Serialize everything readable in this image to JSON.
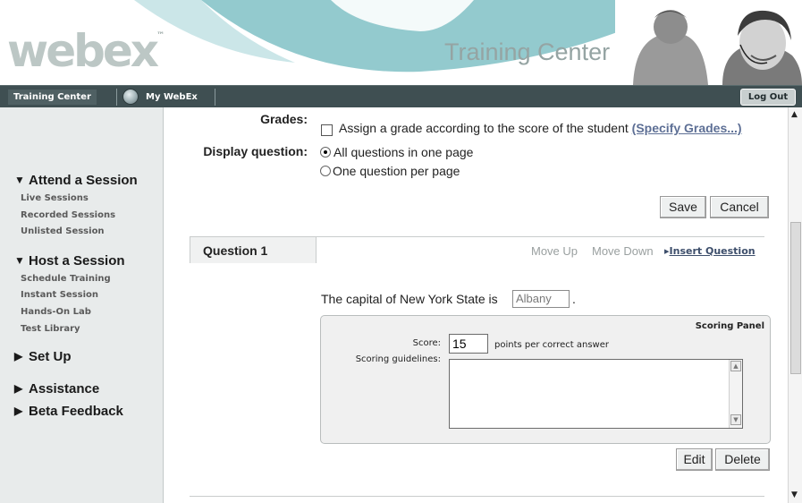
{
  "header": {
    "logo": "webex",
    "logo_tm": "™",
    "title": "Training Center"
  },
  "nav": {
    "tab_training_center": "Training Center",
    "tab_my_webex": "My WebEx",
    "logout": "Log Out"
  },
  "sidebar": {
    "sections": [
      {
        "label": "Attend a Session",
        "expanded": true,
        "items": [
          "Live Sessions",
          "Recorded Sessions",
          "Unlisted Session"
        ]
      },
      {
        "label": "Host a Session",
        "expanded": true,
        "items": [
          "Schedule Training",
          "Instant Session",
          "Hands-On Lab",
          "Test Library"
        ]
      },
      {
        "label": "Set Up",
        "expanded": false,
        "items": []
      },
      {
        "label": "Assistance",
        "expanded": false,
        "items": []
      },
      {
        "label": "Beta Feedback",
        "expanded": false,
        "items": []
      }
    ]
  },
  "settings": {
    "grades_label": "Grades:",
    "grades_checkbox_text": "Assign a grade according to the score of the student",
    "grades_checked": false,
    "specify_grades_link": "(Specify Grades...)",
    "display_label": "Display question:",
    "display_options": [
      "All questions in one page",
      "One question per page"
    ],
    "display_selected": "All questions in one page",
    "save_button": "Save",
    "cancel_button": "Cancel"
  },
  "question": {
    "tab_label": "Question 1",
    "move_up": "Move Up",
    "move_down": "Move Down",
    "insert_question": "Insert Question",
    "prompt": "The capital of New York State is",
    "answer": "Albany",
    "prompt_end": ".",
    "scoring_panel": {
      "title": "Scoring Panel",
      "score_label": "Score:",
      "score_value": "15",
      "score_suffix": "points per correct answer",
      "guidelines_label": "Scoring guidelines:",
      "guidelines_value": ""
    },
    "edit_button": "Edit",
    "delete_button": "Delete"
  },
  "colors": {
    "nav_bg": "#3f4f52",
    "sidebar_bg": "#e8ebeb",
    "link": "#5d6f95",
    "header_swoosh": "#6fb8bd"
  },
  "icons": [
    "globe-icon",
    "triangle-down-icon",
    "triangle-right-icon",
    "play-arrow-icon",
    "scroll-up-icon",
    "scroll-down-icon"
  ]
}
